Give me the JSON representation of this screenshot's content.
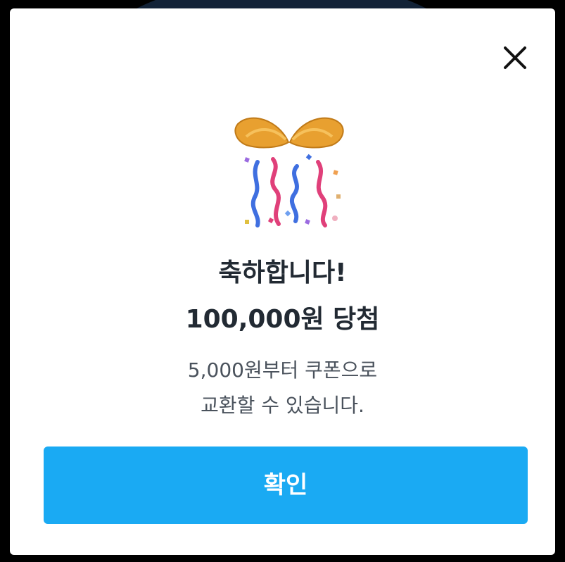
{
  "dialog": {
    "title_line1": "축하합니다!",
    "title_line2": "100,000원 당첨",
    "description_line1": "5,000원부터 쿠폰으로",
    "description_line2": "교환할 수 있습니다.",
    "confirm_label": "확인",
    "close_icon": "close-icon",
    "illustration_icon": "gift-box-icon"
  },
  "colors": {
    "confirm_button": "#1aaaf3",
    "title_text": "#222a33",
    "description_text": "#4a525c",
    "bow": "#e8a030"
  }
}
